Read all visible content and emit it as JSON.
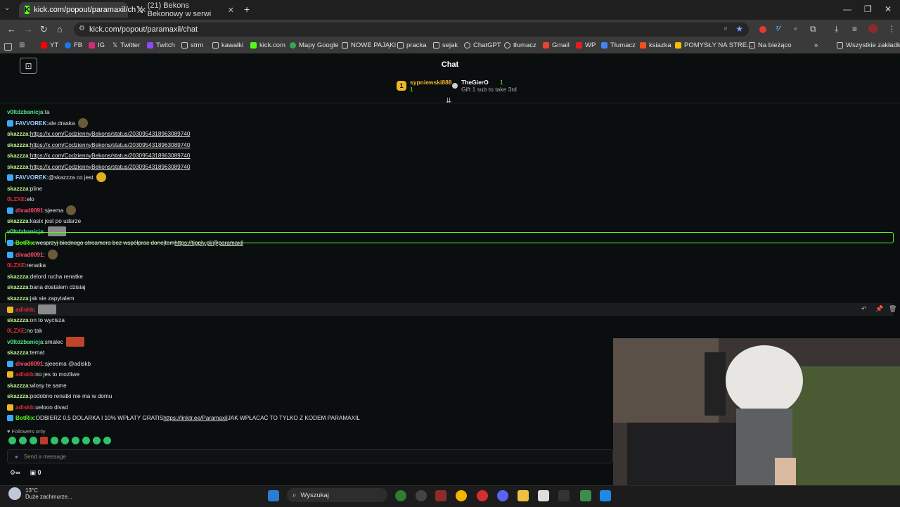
{
  "browser": {
    "tabs": [
      {
        "title": "kick.com/popout/paramaxil/ch",
        "active": true
      },
      {
        "title": "(21) Bekons Bekonowy w serwi",
        "active": false
      }
    ],
    "new_tab": "+",
    "url": "kick.com/popout/paramaxil/chat",
    "bookmarks": [
      "YT",
      "FB",
      "IG",
      "Twitter",
      "Twitch",
      "strm",
      "kawałki",
      "kick.com",
      "Mapy Google",
      "NOWE PAJĄKI",
      "pracka",
      "sejak",
      "ChatGPT",
      "tłumacz",
      "Gmail",
      "WP",
      "Tłumacz",
      "ksiazka",
      "POMYSŁY NA STRE...",
      "Na bieżąco"
    ],
    "all_bookmarks": "Wszystkie zakładki",
    "more": "»"
  },
  "header": {
    "title": "Chat",
    "leaderboard": [
      {
        "rank": "1",
        "name": "sypniewski888",
        "count": "1"
      },
      {
        "name": "TheGierO",
        "count": "1",
        "sub": "Gift 1 sub to take 3rd"
      }
    ]
  },
  "messages": [
    {
      "user": "v0ltdzbanicja",
      "color": "#4ee38a",
      "text": "ta"
    },
    {
      "user": "FAVVOREK",
      "color": "#9ec7ff",
      "text": "ale draska"
    },
    {
      "user": "skazzza",
      "color": "#b8f58a",
      "text": "",
      "link": "https://x.com/CodziennyBekons/status/2030954318963089740"
    },
    {
      "user": "skazzza",
      "color": "#b8f58a",
      "text": "",
      "link": "https://x.com/CodziennyBekons/status/2030954318963089740"
    },
    {
      "user": "skazzza",
      "color": "#b8f58a",
      "text": "",
      "link": "https://x.com/CodziennyBekons/status/2030954318963089740"
    },
    {
      "user": "skazzza",
      "color": "#b8f58a",
      "text": "",
      "link": "https://x.com/CodziennyBekons/status/2030954318963089740"
    },
    {
      "user": "FAVVOREK",
      "color": "#9ec7ff",
      "text": "@skazzza co jest"
    },
    {
      "user": "skazzza",
      "color": "#b8f58a",
      "text": "pline"
    },
    {
      "user": "0LZXE",
      "color": "#e0283a",
      "text": "elo"
    },
    {
      "user": "divad0091",
      "color": "#ff4d6d",
      "text": "sjeema"
    },
    {
      "user": "skazzza",
      "color": "#b8f58a",
      "text": "kasix jest po udarze"
    },
    {
      "user": "v0ltdzbanicja",
      "color": "#4ee38a",
      "text": ""
    },
    {
      "user": "BotRix",
      "color": "#53fc18",
      "text": "wesprzyj biednego streamera bez współprac donejtem",
      "link": "https://tipply.pl/@paramaxil"
    },
    {
      "user": "divad0091",
      "color": "#ff4d6d",
      "text": ""
    },
    {
      "user": "0LZXE",
      "color": "#e0283a",
      "text": "renatka"
    },
    {
      "user": "skazzza",
      "color": "#b8f58a",
      "text": "delord rucha renatke"
    },
    {
      "user": "skazzza",
      "color": "#b8f58a",
      "text": "bana dostalem dzisiaj"
    },
    {
      "user": "skazzza",
      "color": "#b8f58a",
      "text": "jak sie zapytalem"
    },
    {
      "user": "adiskb",
      "color": "#e0283a",
      "text": ""
    },
    {
      "user": "skazzza",
      "color": "#b8f58a",
      "text": "on to wycisza"
    },
    {
      "user": "0LZXE",
      "color": "#e0283a",
      "text": "no tak"
    },
    {
      "user": "v0ltdzbanicja",
      "color": "#4ee38a",
      "text": "smalec"
    },
    {
      "user": "skazzza",
      "color": "#b8f58a",
      "text": "temat"
    },
    {
      "user": "divad0091",
      "color": "#ff4d6d",
      "text": "sjeeema @adiskb"
    },
    {
      "user": "adiskb",
      "color": "#e0283a",
      "text": "no jes to mozliwe"
    },
    {
      "user": "skazzza",
      "color": "#b8f58a",
      "text": "wlosy te same"
    },
    {
      "user": "skazzza",
      "color": "#b8f58a",
      "text": "podobno renatki nie ma w domu"
    },
    {
      "user": "adiskb",
      "color": "#e0283a",
      "text": "uelooo divad"
    },
    {
      "user": "BotRix",
      "color": "#53fc18",
      "text": "ODBIERZ 0,5 DOLARKA I 10% WPŁATY GRATIS",
      "link": "https://linktr.ee/Paramaxil",
      "text2": "JAK WPŁACAĆ TO TYLKO Z KODEM PARAMAXIL"
    }
  ],
  "footer": {
    "followers_only": "Followers only",
    "send_placeholder": "Send a message",
    "points": "0"
  },
  "taskbar": {
    "temp": "13°C",
    "weather": "Duże zachmurze...",
    "search": "Wyszukaj"
  },
  "colors": {
    "accent": "#53fc18",
    "bg": "#0b0e0f"
  }
}
